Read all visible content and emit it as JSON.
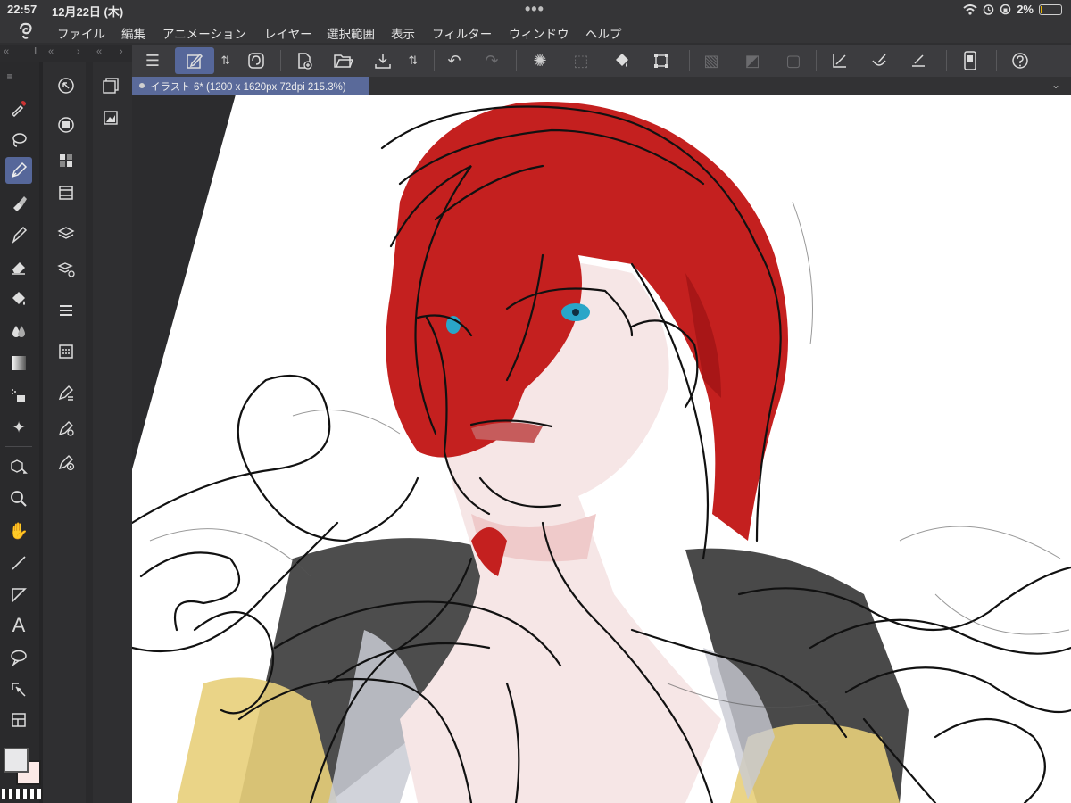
{
  "status": {
    "time": "22:57",
    "date": "12月22日 (木)",
    "battery": "2%"
  },
  "menu": [
    "ファイル",
    "編集",
    "アニメーション",
    "レイヤー",
    "選択範囲",
    "表示",
    "フィルター",
    "ウィンドウ",
    "ヘルプ"
  ],
  "tab": {
    "title": "イラスト 6* (1200 x 1620px 72dpi 215.3%)"
  },
  "colors": {
    "accent": "#56679a",
    "hair": "#c4201f",
    "jacket": "#3a3a3a",
    "yellow": "#e8cf7a"
  }
}
